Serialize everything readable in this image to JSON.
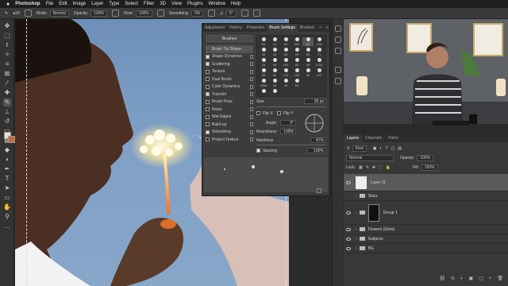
{
  "menubar": {
    "apple": "",
    "items": [
      "Photoshop",
      "File",
      "Edit",
      "Image",
      "Layer",
      "Type",
      "Select",
      "Filter",
      "3D",
      "View",
      "Plugins",
      "Window",
      "Help"
    ]
  },
  "options": {
    "size": "29",
    "mode_label": "Mode:",
    "mode_value": "Normal",
    "opacity_label": "Opacity:",
    "opacity_value": "100%",
    "flow_label": "Flow:",
    "flow_value": "100%",
    "smoothing_label": "Smoothing:",
    "smoothing_value": "0%",
    "angle_value": "0°"
  },
  "brush_settings": {
    "tabs": [
      "Adjustment",
      "History",
      "Properties",
      "Brush Settings",
      "Brushes"
    ],
    "active_tab": "Brush Settings",
    "brushes_button": "Brushes",
    "options": [
      {
        "label": "Brush Tip Shape",
        "checked": null,
        "selected": true
      },
      {
        "label": "Shape Dynamics",
        "checked": true,
        "selected": false
      },
      {
        "label": "Scattering",
        "checked": true,
        "selected": false
      },
      {
        "label": "Texture",
        "checked": false,
        "selected": false
      },
      {
        "label": "Dual Brush",
        "checked": false,
        "selected": false
      },
      {
        "label": "Color Dynamics",
        "checked": false,
        "selected": false
      },
      {
        "label": "Transfer",
        "checked": true,
        "selected": false
      },
      {
        "label": "Brush Pose",
        "checked": false,
        "selected": false
      },
      {
        "label": "Noise",
        "checked": false,
        "selected": false
      },
      {
        "label": "Wet Edges",
        "checked": false,
        "selected": false
      },
      {
        "label": "Build-up",
        "checked": false,
        "selected": false
      },
      {
        "label": "Smoothing",
        "checked": true,
        "selected": false
      },
      {
        "label": "Protect Texture",
        "checked": false,
        "selected": false
      }
    ],
    "tip_sizes": [
      "95",
      "13",
      "82",
      "500",
      "29",
      "125",
      "36",
      "25",
      "36",
      "25",
      "50",
      "71",
      "25",
      "50",
      "160",
      "50",
      "46",
      "1210",
      "55",
      "80",
      "175",
      "100",
      "80",
      "110",
      "2056",
      "80",
      "45",
      "65",
      "",
      ""
    ],
    "size_label": "Size",
    "size_value": "29 px",
    "flip_x": "Flip X",
    "flip_y": "Flip Y",
    "angle_label": "Angle:",
    "angle_value": "0°",
    "roundness_label": "Roundness:",
    "roundness_value": "100%",
    "hardness_label": "Hardness",
    "hardness_value": "47%",
    "spacing_label": "Spacing",
    "spacing_value": "100%"
  },
  "layers": {
    "tabs": [
      "Layers",
      "Channels",
      "Paths"
    ],
    "active_tab": "Layers",
    "kind_label": "Kind",
    "blend_mode": "Normal",
    "opacity_label": "Opacity:",
    "opacity_value": "100%",
    "lock_label": "Lock:",
    "fill_label": "Fill:",
    "fill_value": "100%",
    "items": [
      {
        "name": "Layer 11",
        "type": "layer",
        "visible": true,
        "selected": true
      },
      {
        "name": "Stars",
        "type": "group",
        "visible": false,
        "selected": false
      },
      {
        "name": "Group 1",
        "type": "group",
        "visible": true,
        "selected": false
      },
      {
        "name": "Flowers (Glow)",
        "type": "group",
        "visible": true,
        "selected": false
      },
      {
        "name": "Subjects",
        "type": "group",
        "visible": true,
        "selected": false
      },
      {
        "name": "BG",
        "type": "group",
        "visible": true,
        "selected": false
      }
    ],
    "footer_icons": [
      "fx",
      "◐",
      "▣",
      "▢",
      "+",
      "🗑"
    ]
  },
  "colors": {
    "foreground": "#e9dfd2",
    "background": "#c36a3a",
    "accent": "#ffd84d"
  }
}
